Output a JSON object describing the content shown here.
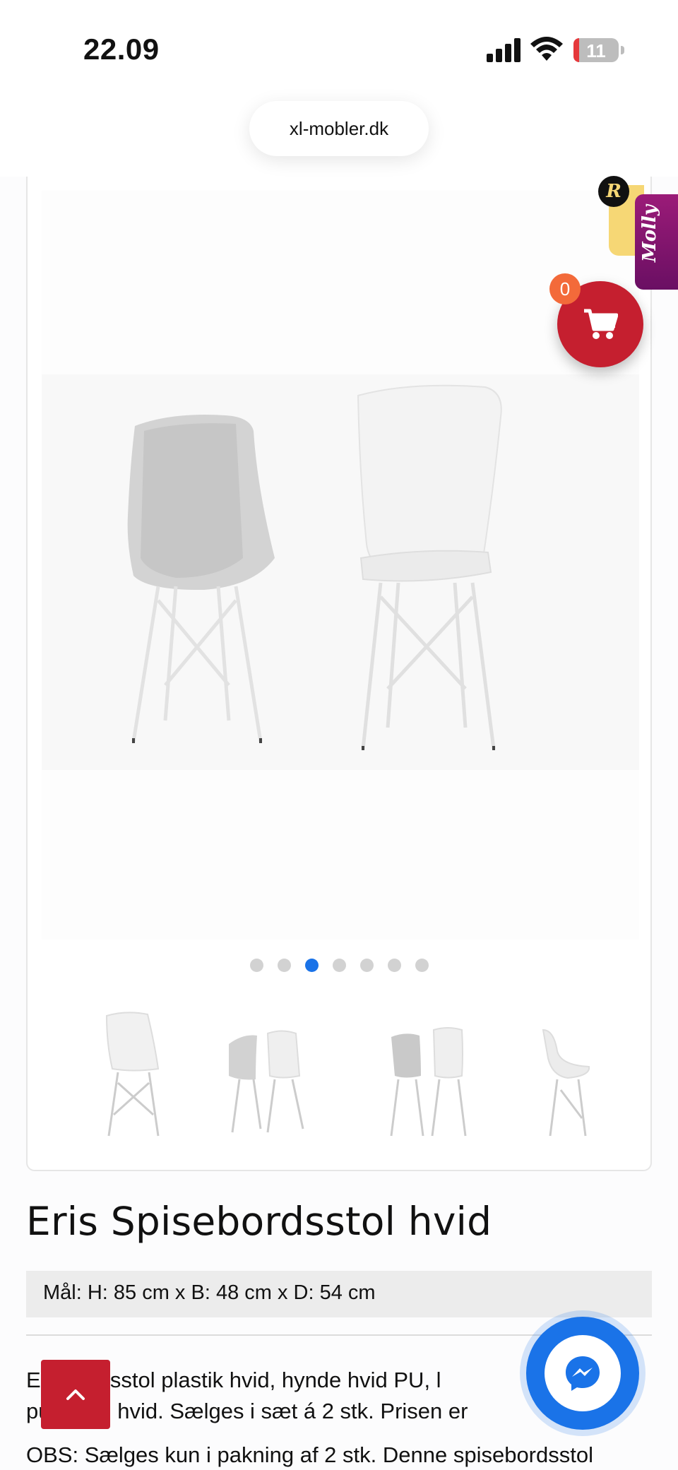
{
  "status_bar": {
    "time": "22.09",
    "battery": "11"
  },
  "browser": {
    "url": "xl-mobler.dk"
  },
  "gallery": {
    "image_count": 7,
    "active_index": 2,
    "thumbnails": [
      "chair-front",
      "chairs-pair-angle",
      "chairs-pair-back-front",
      "chair-side"
    ]
  },
  "widgets": {
    "molly_label": "Molly",
    "rating_badge": "R",
    "cart_count": "0"
  },
  "product": {
    "title": "Eris Spisebordsstol hvid",
    "dimensions": "Mål: H: 85 cm x B: 48 cm x D: 54 cm",
    "description_line1": "Er          ebordsstol plastik hvid, hynde hvid PU, l",
    "description_line2": "pu       keret, hvid. Sælges i sæt á 2 stk. Prisen er",
    "obs": "OBS: Sælges kun i pakning af 2 stk. Denne spisebordsstol"
  },
  "colors": {
    "accent_red": "#c51f2f",
    "messenger_blue": "#1a73e8",
    "active_dot": "#1a73e8"
  }
}
